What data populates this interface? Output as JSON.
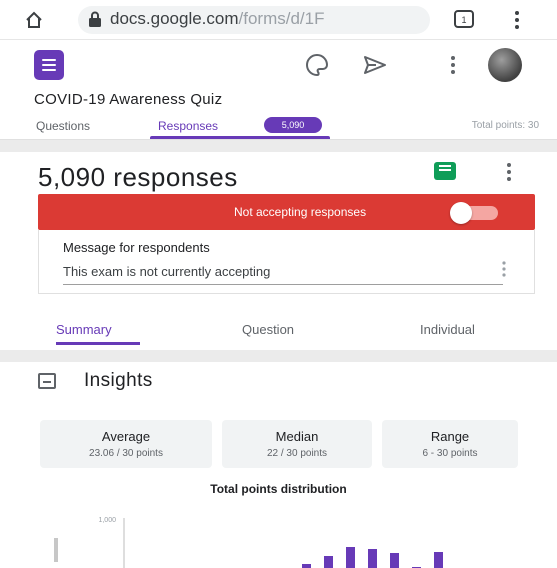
{
  "browser": {
    "url_main": "docs.google.com",
    "url_path": "/forms/d/1F"
  },
  "form": {
    "title": "COVID-19 Awareness Quiz",
    "tabs": [
      {
        "label": "Questions"
      },
      {
        "label": "Responses",
        "badge": "5,090"
      }
    ],
    "total_points": "Total points: 30"
  },
  "responses": {
    "count_label": "5,090 responses",
    "banner_text": "Not accepting responses",
    "accepting": false,
    "message_label": "Message for respondents",
    "message_value": "This exam is not currently accepting",
    "subtabs": [
      "Summary",
      "Question",
      "Individual"
    ]
  },
  "insights": {
    "title": "Insights",
    "stats": [
      {
        "label": "Average",
        "value": "23.06 / 30 points"
      },
      {
        "label": "Median",
        "value": "22 / 30 points"
      },
      {
        "label": "Range",
        "value": "6 - 30 points"
      }
    ]
  },
  "colors": {
    "accent": "#673ab7",
    "banner": "#db3a34",
    "sheets": "#0f9d58"
  },
  "chart_data": {
    "type": "bar",
    "title": "Total points distribution",
    "ylabel": "",
    "y_ticks": [
      "1,000",
      "",
      ""
    ],
    "values": [
      80,
      240,
      420,
      380,
      300,
      20,
      320
    ]
  }
}
